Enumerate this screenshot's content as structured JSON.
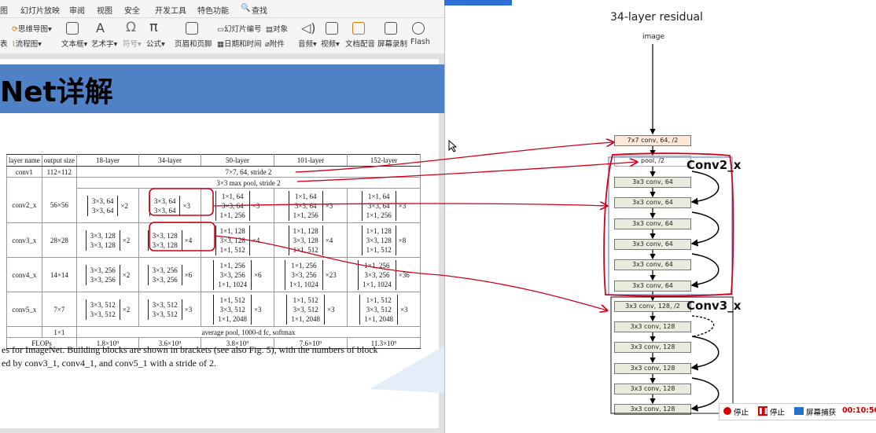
{
  "ribbon": {
    "tabs": [
      "图",
      "幻灯片放映",
      "审阅",
      "视图",
      "安全",
      "开发工具",
      "特色功能",
      "查找"
    ],
    "row1": [
      "思维导图",
      "对象"
    ],
    "row2": [
      "表",
      "流程图",
      "文本框",
      "艺术字",
      "符号",
      "公式",
      "页眉和页脚",
      "幻灯片编号",
      "日期和时间",
      "附件",
      "音频",
      "视频",
      "文档配音",
      "屏幕录制",
      "Flash"
    ]
  },
  "slide": {
    "title": "Net详解",
    "caption_line1": "es for ImageNet. Building blocks are shown in brackets (see also Fig. 5), with the numbers of block",
    "caption_line2": "ed by conv3_1, conv4_1, and conv5_1 with a stride of 2."
  },
  "table": {
    "headers": [
      "layer name",
      "output size",
      "18-layer",
      "34-layer",
      "50-layer",
      "101-layer",
      "152-layer"
    ],
    "conv1": {
      "name": "conv1",
      "size": "112×112",
      "desc": "7×7, 64, stride 2"
    },
    "pool": "3×3 max pool, stride 2",
    "conv2": {
      "name": "conv2_x",
      "size": "56×56",
      "c18": [
        "3×3, 64",
        "3×3, 64"
      ],
      "m18": "×2",
      "c34": [
        "3×3, 64",
        "3×3, 64"
      ],
      "m34": "×3",
      "c50": [
        "1×1, 64",
        "3×3, 64",
        "1×1, 256"
      ],
      "m50": "×3",
      "c101": [
        "1×1, 64",
        "3×3, 64",
        "1×1, 256"
      ],
      "m101": "×3",
      "c152": [
        "1×1, 64",
        "3×3, 64",
        "1×1, 256"
      ],
      "m152": "×3"
    },
    "conv3": {
      "name": "conv3_x",
      "size": "28×28",
      "c18": [
        "3×3, 128",
        "3×3, 128"
      ],
      "m18": "×2",
      "c34": [
        "3×3, 128",
        "3×3, 128"
      ],
      "m34": "×4",
      "c50": [
        "1×1, 128",
        "3×3, 128",
        "1×1, 512"
      ],
      "m50": "×4",
      "c101": [
        "1×1, 128",
        "3×3, 128",
        "1×1, 512"
      ],
      "m101": "×4",
      "c152": [
        "1×1, 128",
        "3×3, 128",
        "1×1, 512"
      ],
      "m152": "×8"
    },
    "conv4": {
      "name": "conv4_x",
      "size": "14×14",
      "c18": [
        "3×3, 256",
        "3×3, 256"
      ],
      "m18": "×2",
      "c34": [
        "3×3, 256",
        "3×3, 256"
      ],
      "m34": "×6",
      "c50": [
        "1×1, 256",
        "3×3, 256",
        "1×1, 1024"
      ],
      "m50": "×6",
      "c101": [
        "1×1, 256",
        "3×3, 256",
        "1×1, 1024"
      ],
      "m101": "×23",
      "c152": [
        "1×1, 256",
        "3×3, 256",
        "1×1, 1024"
      ],
      "m152": "×36"
    },
    "conv5": {
      "name": "conv5_x",
      "size": "7×7",
      "c18": [
        "3×3, 512",
        "3×3, 512"
      ],
      "m18": "×2",
      "c34": [
        "3×3, 512",
        "3×3, 512"
      ],
      "m34": "×3",
      "c50": [
        "1×1, 512",
        "3×3, 512",
        "1×1, 2048"
      ],
      "m50": "×3",
      "c101": [
        "1×1, 512",
        "3×3, 512",
        "1×1, 2048"
      ],
      "m101": "×3",
      "c152": [
        "1×1, 512",
        "3×3, 512",
        "1×1, 2048"
      ],
      "m152": "×3"
    },
    "final": {
      "size": "1×1",
      "desc": "average pool, 1000-d fc, softmax"
    },
    "flops": {
      "name": "FLOPs",
      "f18": "1.8×10⁹",
      "f34": "3.6×10⁹",
      "f50": "3.8×10⁹",
      "f101": "7.6×10⁹",
      "f152": "11.3×10⁹"
    }
  },
  "diagram": {
    "title": "34-layer residual",
    "input": "image",
    "conv1": "7x7 conv, 64, /2",
    "pool": "pool, /2",
    "conv2_nodes": [
      "3x3 conv, 64",
      "3x3 conv, 64",
      "3x3 conv, 64",
      "3x3 conv, 64",
      "3x3 conv, 64",
      "3x3 conv, 64"
    ],
    "conv3_nodes": [
      "3x3 conv, 128, /2",
      "3x3 conv, 128",
      "3x3 conv, 128",
      "3x3 conv, 128",
      "3x3 conv, 128",
      "3x3 conv, 128"
    ],
    "label_conv2": "Conv2_x",
    "label_conv3": "Conv3_x"
  },
  "recorder": {
    "stop1": "停止",
    "stop2": "停止",
    "capture": "屏幕捕获",
    "timer": "00:10:50"
  },
  "colors": {
    "annotation": "#d0001a",
    "banner": "#4f81c7",
    "timer": "#cc0000"
  }
}
